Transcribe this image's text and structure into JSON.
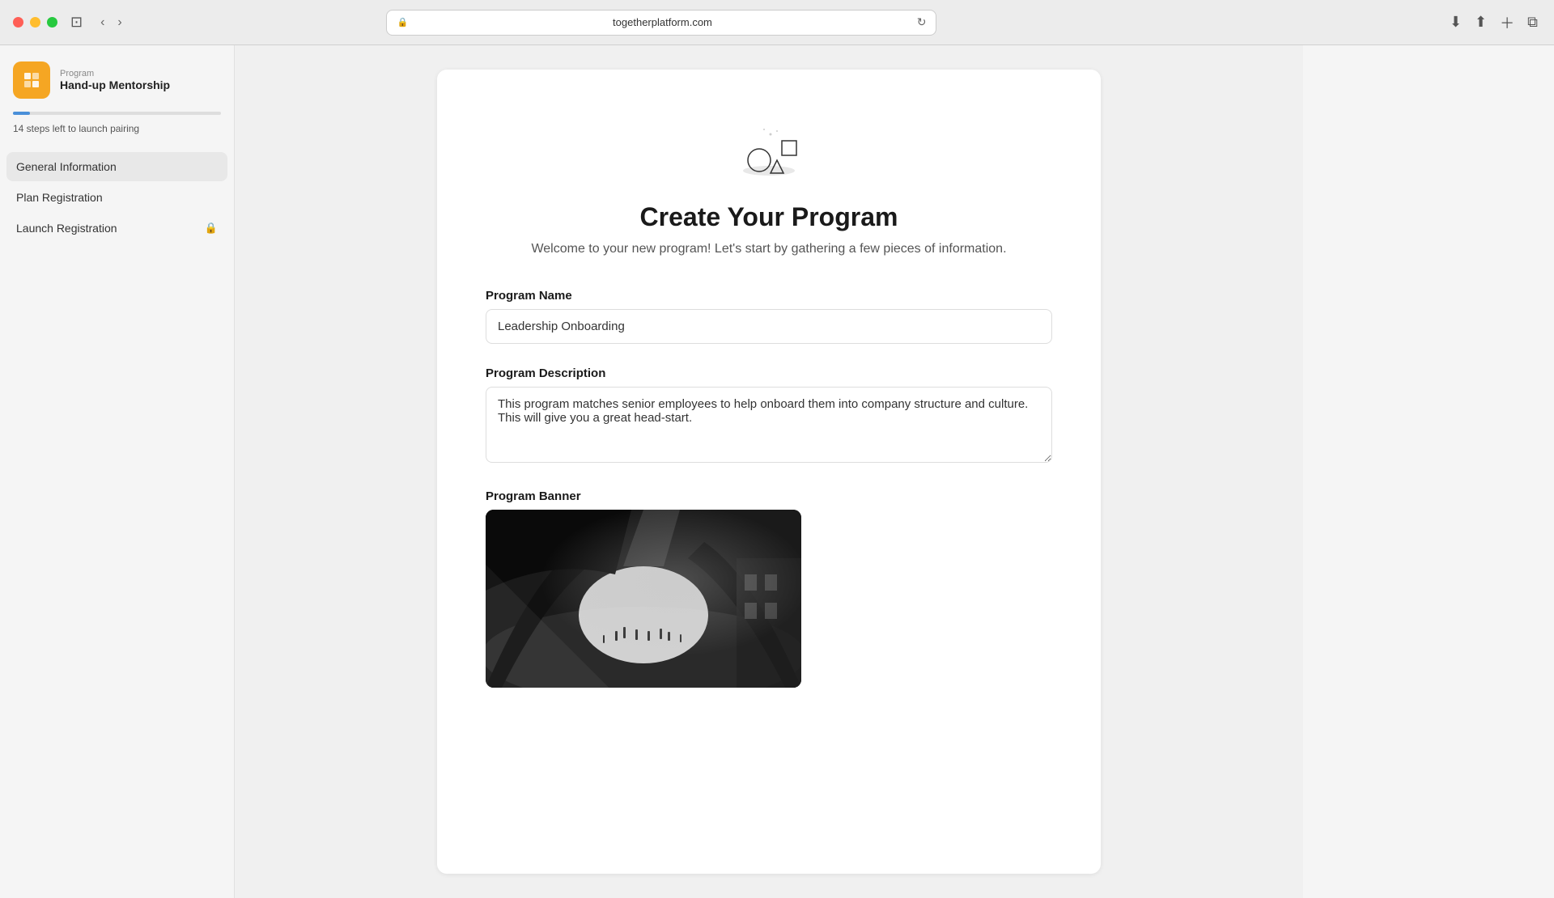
{
  "browser": {
    "url": "togetherplatform.com",
    "reload_label": "↻"
  },
  "sidebar": {
    "program_label": "Program",
    "program_name": "Hand-up Mentorship",
    "progress_steps_left": "14 steps left to launch pairing",
    "nav_items": [
      {
        "id": "general-information",
        "label": "General Information",
        "active": true,
        "locked": false
      },
      {
        "id": "plan-registration",
        "label": "Plan Registration",
        "active": false,
        "locked": false
      },
      {
        "id": "launch-registration",
        "label": "Launch Registration",
        "active": false,
        "locked": true
      }
    ]
  },
  "main": {
    "title": "Create Your Program",
    "subtitle": "Welcome to your new program! Let's start by gathering a few pieces of information.",
    "form": {
      "program_name_label": "Program Name",
      "program_name_value": "Leadership Onboarding",
      "program_description_label": "Program Description",
      "program_description_value": "This program matches senior employees to help onboard them into company structure and culture. This will give you a great head-start.",
      "program_banner_label": "Program Banner"
    }
  }
}
